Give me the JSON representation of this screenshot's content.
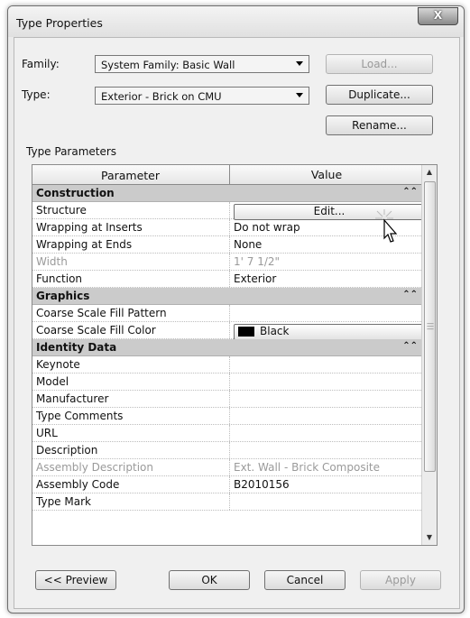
{
  "window": {
    "title": "Type Properties",
    "close_label": "X"
  },
  "family": {
    "label": "Family:",
    "value": "System Family: Basic Wall",
    "load_label": "Load..."
  },
  "type": {
    "label": "Type:",
    "value": "Exterior - Brick on CMU",
    "duplicate_label": "Duplicate...",
    "rename_label": "Rename..."
  },
  "params": {
    "section_label": "Type Parameters",
    "col_parameter": "Parameter",
    "col_value": "Value",
    "groups": {
      "construction": {
        "name": "Construction",
        "structure": {
          "name": "Structure",
          "value": "Edit..."
        },
        "wrapping_inserts": {
          "name": "Wrapping at Inserts",
          "value": "Do not wrap"
        },
        "wrapping_ends": {
          "name": "Wrapping at Ends",
          "value": "None"
        },
        "width": {
          "name": "Width",
          "value": "1'  7 1/2\""
        },
        "function": {
          "name": "Function",
          "value": "Exterior"
        }
      },
      "graphics": {
        "name": "Graphics",
        "fill_pattern": {
          "name": "Coarse Scale Fill Pattern",
          "value": ""
        },
        "fill_color": {
          "name": "Coarse Scale Fill Color",
          "value": "Black",
          "swatch": "#000000"
        }
      },
      "identity": {
        "name": "Identity Data",
        "keynote": {
          "name": "Keynote",
          "value": ""
        },
        "model": {
          "name": "Model",
          "value": ""
        },
        "manufacturer": {
          "name": "Manufacturer",
          "value": ""
        },
        "type_comments": {
          "name": "Type Comments",
          "value": ""
        },
        "url": {
          "name": "URL",
          "value": ""
        },
        "description": {
          "name": "Description",
          "value": ""
        },
        "assembly_description": {
          "name": "Assembly Description",
          "value": "Ext. Wall - Brick Composite"
        },
        "assembly_code": {
          "name": "Assembly Code",
          "value": "B2010156"
        },
        "type_mark": {
          "name": "Type Mark",
          "value": ""
        }
      }
    }
  },
  "footer": {
    "preview_label": "<< Preview",
    "ok_label": "OK",
    "cancel_label": "Cancel",
    "apply_label": "Apply"
  },
  "icons": {
    "collapse": "chevron-double-up-icon",
    "scroll_up": "scroll-up-arrow-icon",
    "scroll_down": "scroll-down-arrow-icon",
    "cursor": "mouse-pointer-icon",
    "combo": "chevron-down-icon"
  }
}
